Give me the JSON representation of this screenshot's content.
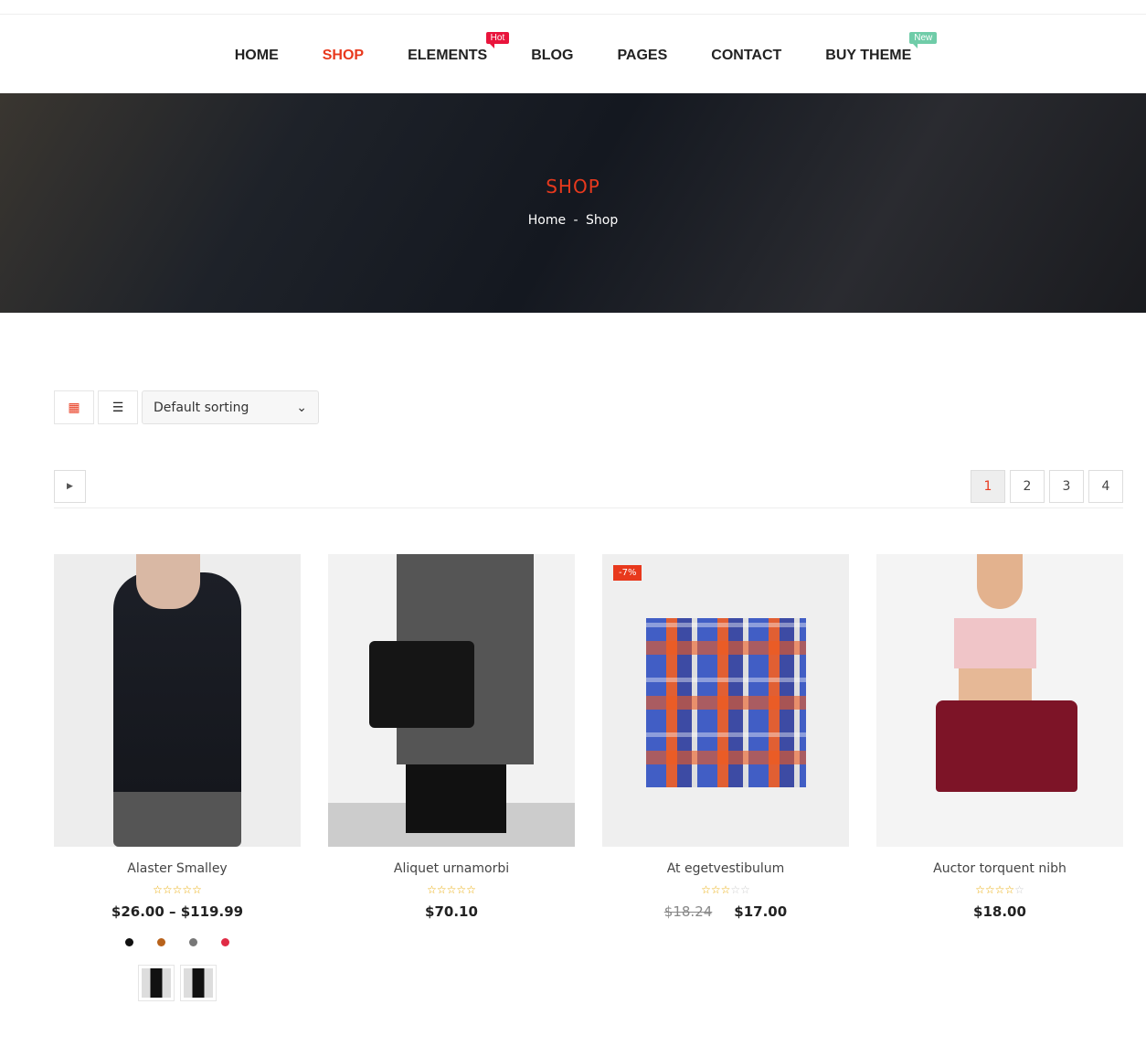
{
  "nav": {
    "items": [
      {
        "label": "HOME"
      },
      {
        "label": "SHOP",
        "active": true
      },
      {
        "label": "ELEMENTS",
        "badge": "Hot"
      },
      {
        "label": "BLOG"
      },
      {
        "label": "PAGES"
      },
      {
        "label": "CONTACT"
      },
      {
        "label": "BUY THEME",
        "badge": "New"
      }
    ]
  },
  "hero": {
    "title": "SHOP",
    "breadcrumb": [
      "Home",
      "-",
      "Shop"
    ]
  },
  "toolbar": {
    "sort_value": "Default sorting"
  },
  "pagination": {
    "pages": [
      "1",
      "2",
      "3",
      "4"
    ],
    "current": "1"
  },
  "colors": {
    "accent": "#e8391d",
    "hot": "#e9143c",
    "new": "#6fcca8",
    "star": "#e9a800"
  },
  "products": [
    {
      "name": "Alaster Smalley",
      "rating": 5,
      "price": "$26.00 – $119.99",
      "swatches": [
        "#111111",
        "#b8621b",
        "#777777",
        "#e02b45"
      ],
      "thumbs": 2
    },
    {
      "name": "Aliquet urnamorbi",
      "rating": 5,
      "price": "$70.10"
    },
    {
      "name": "At egetvestibulum",
      "rating": 3,
      "old_price": "$18.24",
      "price": "$17.00",
      "sale": "-7%"
    },
    {
      "name": "Auctor torquent nibh",
      "rating": 4,
      "price": "$18.00"
    }
  ]
}
